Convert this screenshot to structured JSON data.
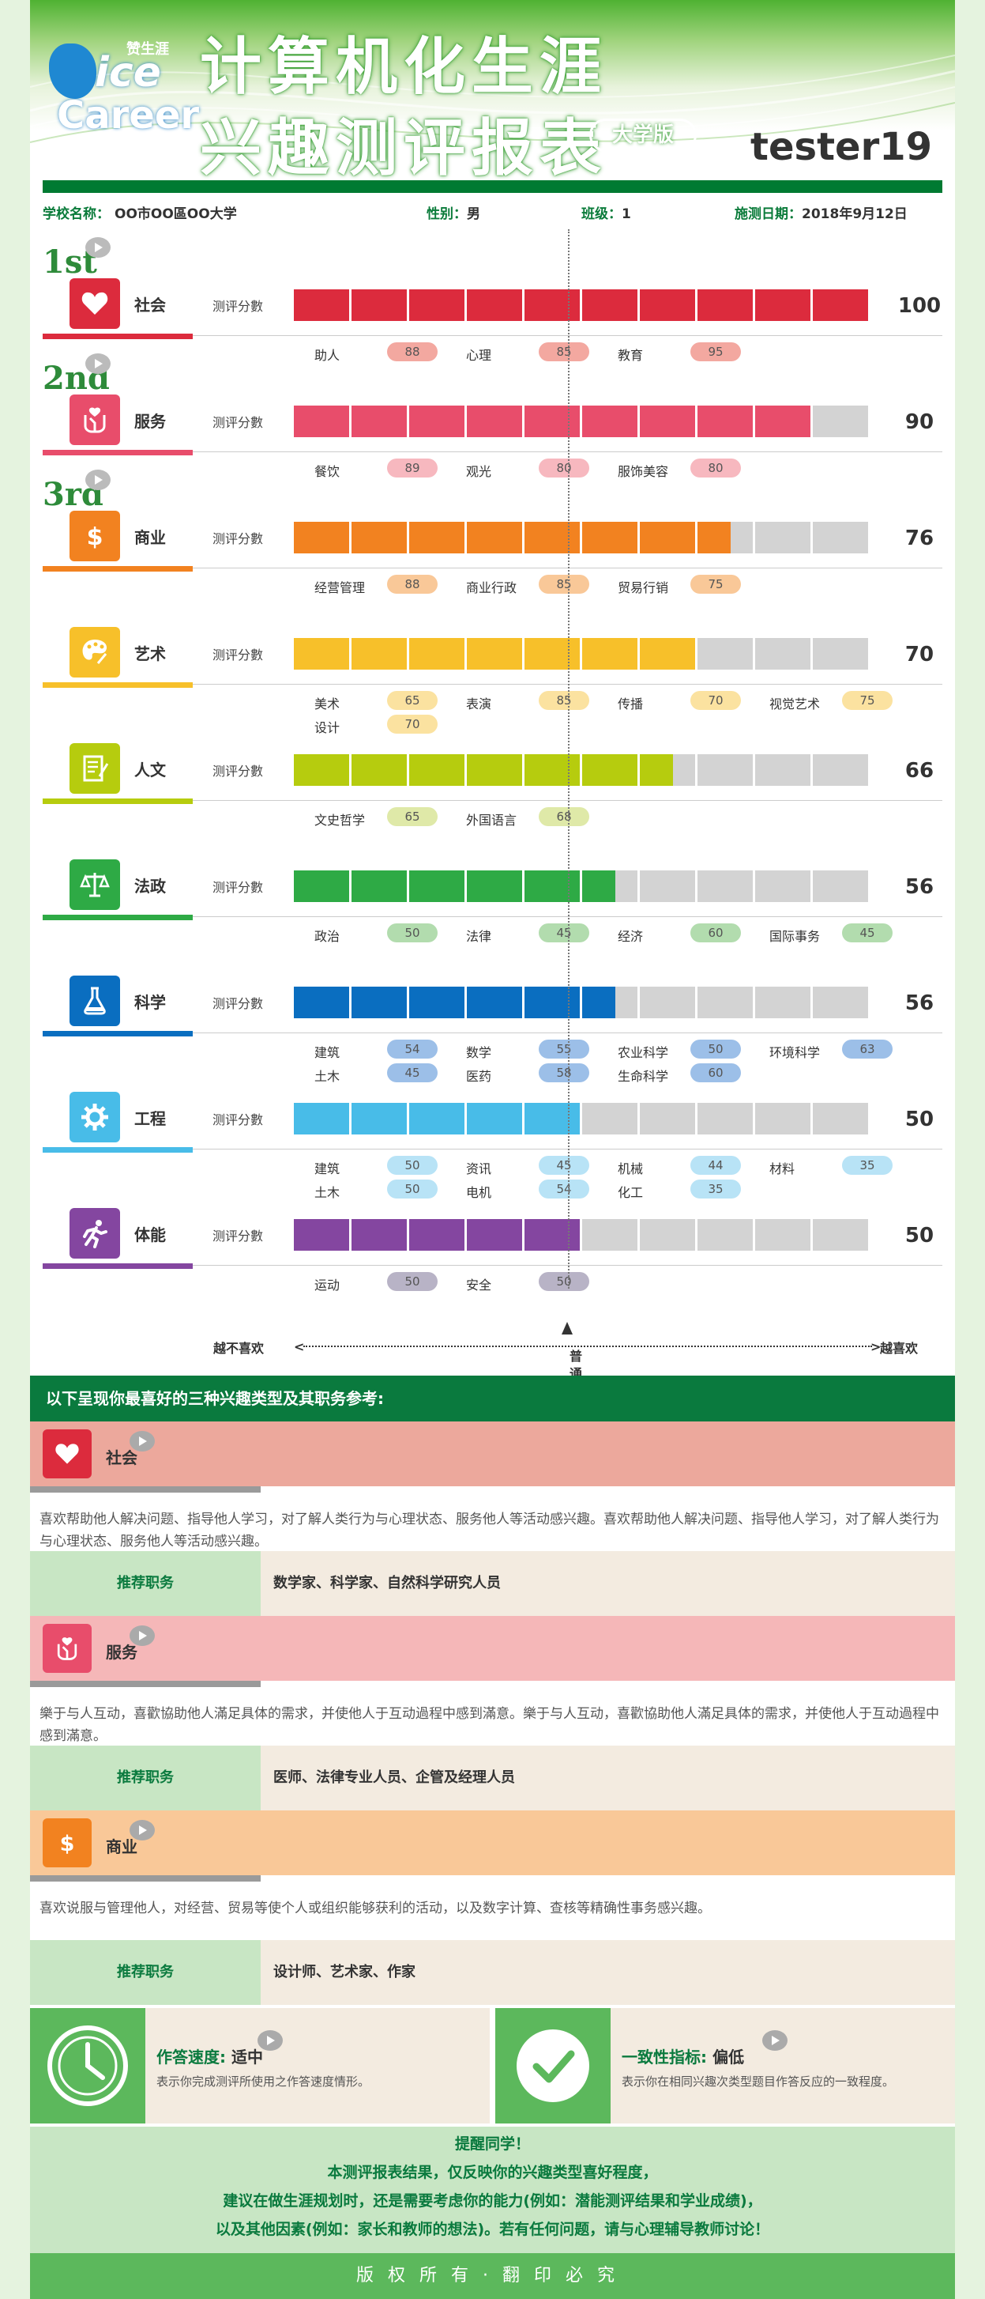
{
  "header": {
    "logo_cn": "赞生涯",
    "logo_ice": "ice",
    "logo_career": "Career",
    "title_line1": "计算机化生涯",
    "title_line2": "兴趣测评报表",
    "edition": "大学版",
    "user": "tester19"
  },
  "info": {
    "school_label": "学校名称：",
    "school": "OO市OO區OO大学",
    "gender_label": "性别：",
    "gender": "男",
    "class_label": "班级：",
    "class": "1",
    "date_label": "施测日期：",
    "date": "2018年9月12日"
  },
  "score_label": "测评分數",
  "ranks": [
    "1st",
    "2nd",
    "3rd"
  ],
  "categories": [
    {
      "name": "社会",
      "score": 100,
      "color": "#dc2b3d",
      "icon": "heart-icon",
      "pill": "#f3a8a0",
      "subs": [
        [
          "助人",
          "88"
        ],
        [
          "心理",
          "85"
        ],
        [
          "教育",
          "95"
        ]
      ]
    },
    {
      "name": "服务",
      "score": 90,
      "color": "#e84d6b",
      "icon": "service-hands-icon",
      "pill": "#f7b8bf",
      "subs": [
        [
          "餐饮",
          "89"
        ],
        [
          "观光",
          "80"
        ],
        [
          "服饰美容",
          "80"
        ]
      ]
    },
    {
      "name": "商业",
      "score": 76,
      "color": "#f28220",
      "icon": "dollar-icon",
      "pill": "#f9c898",
      "subs": [
        [
          "经营管理",
          "88"
        ],
        [
          "商业行政",
          "85"
        ],
        [
          "贸易行销",
          "75"
        ]
      ]
    },
    {
      "name": "艺术",
      "score": 70,
      "color": "#f7c02a",
      "icon": "palette-icon",
      "pill": "#fbe2a0",
      "subs": [
        [
          "美术",
          "65"
        ],
        [
          "表演",
          "85"
        ],
        [
          "传播",
          "70"
        ],
        [
          "视觉艺术",
          "75"
        ],
        [
          "设计",
          "70"
        ]
      ]
    },
    {
      "name": "人文",
      "score": 66,
      "color": "#b6cc0e",
      "icon": "document-icon",
      "pill": "#dfe9a8",
      "subs": [
        [
          "文史哲学",
          "65"
        ],
        [
          "外国语言",
          "68"
        ]
      ]
    },
    {
      "name": "法政",
      "score": 56,
      "color": "#2eaa45",
      "icon": "scales-icon",
      "pill": "#b2dcae",
      "subs": [
        [
          "政治",
          "50"
        ],
        [
          "法律",
          "45"
        ],
        [
          "经济",
          "60"
        ],
        [
          "国际事务",
          "45"
        ]
      ]
    },
    {
      "name": "科学",
      "score": 56,
      "color": "#0a6ec0",
      "icon": "flask-icon",
      "pill": "#9cbfe8",
      "subs": [
        [
          "建筑",
          "54"
        ],
        [
          "数学",
          "55"
        ],
        [
          "农业科学",
          "50"
        ],
        [
          "环境科学",
          "63"
        ],
        [
          "土木",
          "45"
        ],
        [
          "医药",
          "58"
        ],
        [
          "生命科学",
          "60"
        ]
      ]
    },
    {
      "name": "工程",
      "score": 50,
      "color": "#48bce8",
      "icon": "gear-icon",
      "pill": "#b8e3f6",
      "subs": [
        [
          "建筑",
          "50"
        ],
        [
          "资讯",
          "45"
        ],
        [
          "机械",
          "44"
        ],
        [
          "材料",
          "35"
        ],
        [
          "土木",
          "50"
        ],
        [
          "电机",
          "54"
        ],
        [
          "化工",
          "35"
        ]
      ]
    },
    {
      "name": "体能",
      "score": 50,
      "color": "#8446a0",
      "icon": "runner-icon",
      "pill": "#b8b3c6",
      "subs": [
        [
          "运动",
          "50"
        ],
        [
          "安全",
          "50"
        ]
      ]
    }
  ],
  "scale": {
    "left": "越不喜欢",
    "middle": "普通",
    "right": "越喜欢",
    "lt": "<",
    "gt": ">"
  },
  "section_title": "以下呈现你最喜好的三种兴趣类型及其职务参考:",
  "top3": [
    {
      "name": "社会",
      "color": "#dc2b3d",
      "band": "#eca89c",
      "desc": "喜欢帮助他人解决问题、指导他人学习，对了解人类行为与心理状态、服务他人等活动感兴趣。喜欢帮助他人解决问题、指导他人学习，对了解人类行为与心理状态、服务他人等活动感兴趣。",
      "rec_label": "推荐职务",
      "rec": "数学家、科学家、自然科学研究人员"
    },
    {
      "name": "服务",
      "color": "#e84d6b",
      "band": "#f5b7b8",
      "desc": "樂于与人互动，喜歡協助他人滿足具体的需求，并使他人于互动過程中感到滿意。樂于与人互动，喜歡協助他人滿足具体的需求，并使他人于互动過程中感到滿意。",
      "rec_label": "推荐职务",
      "rec": "医师、法律专业人员、企管及经理人员"
    },
    {
      "name": "商业",
      "color": "#f28220",
      "band": "#f9c898",
      "desc": "喜欢说服与管理他人，对经营、贸易等使个人或组织能够获利的活动，以及数字计算、查核等精确性事务感兴趣。",
      "rec_label": "推荐职务",
      "rec": "设计师、艺术家、作家"
    }
  ],
  "stats": {
    "speed_label": "作答速度:",
    "speed_value": "适中",
    "speed_desc": "表示你完成测评所使用之作答速度情形。",
    "consistency_label": "一致性指标:",
    "consistency_value": "偏低",
    "consistency_desc": "表示你在相同兴趣次类型题目作答反应的一致程度。"
  },
  "note": {
    "l1": "提醒同学！",
    "l2": "本测评报表结果，仅反映你的兴趣类型喜好程度，",
    "l3": "建议在做生涯规划时，还是需要考虑你的能力(例如：潜能测评结果和学业成绩)，",
    "l4": "以及其他因素(例如：家长和教师的想法)。若有任何问题，请与心理辅导教师讨论！"
  },
  "footer": "版权所有·翻印必究"
}
